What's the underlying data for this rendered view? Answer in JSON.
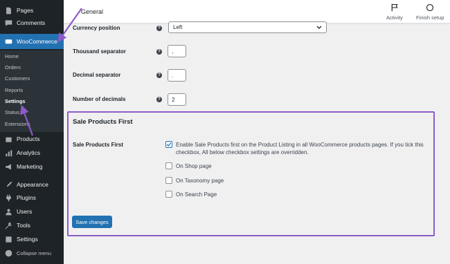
{
  "sidebar": {
    "top_items": [
      {
        "label": "Pages",
        "icon": "pages-icon"
      },
      {
        "label": "Comments",
        "icon": "comments-icon"
      },
      {
        "label": "WooCommerce",
        "icon": "woocommerce-icon"
      }
    ],
    "sub_items": [
      "Home",
      "Orders",
      "Customers",
      "Reports",
      "Settings",
      "Status",
      "Extensions"
    ],
    "bottom_items": [
      {
        "label": "Products",
        "icon": "products-icon"
      },
      {
        "label": "Analytics",
        "icon": "analytics-icon"
      },
      {
        "label": "Marketing",
        "icon": "marketing-icon"
      },
      {
        "label": "Appearance",
        "icon": "appearance-icon"
      },
      {
        "label": "Plugins",
        "icon": "plugins-icon"
      },
      {
        "label": "Users",
        "icon": "users-icon"
      },
      {
        "label": "Tools",
        "icon": "tools-icon"
      },
      {
        "label": "Settings",
        "icon": "settings-icon"
      },
      {
        "label": "Collapse menu",
        "icon": "collapse-icon"
      }
    ]
  },
  "topbar": {
    "title": "General",
    "activity_label": "Activity",
    "finish_setup_label": "Finish setup"
  },
  "form": {
    "currency_position": {
      "label": "Currency position",
      "value": "Left"
    },
    "thousand_separator": {
      "label": "Thousand separator",
      "value": ","
    },
    "decimal_separator": {
      "label": "Decimal separator",
      "value": "."
    },
    "number_of_decimals": {
      "label": "Number of decimals",
      "value": "2"
    }
  },
  "sale_products": {
    "section_title": "Sale Products First",
    "row_label": "Sale Products First",
    "enable_label": "Enable Sale Products first on the Product Listing in all WooCommerce products pages. If you tick this checkbox, All below checkbox settings are overridden.",
    "options": [
      "On Shop page",
      "On Taxonomy page",
      "On Search Page"
    ],
    "enable_checked": true
  },
  "save_button_label": "Save changes",
  "colors": {
    "sidebar_bg": "#1d2327",
    "accent": "#2271b1",
    "highlight": "#8c5bc6"
  }
}
